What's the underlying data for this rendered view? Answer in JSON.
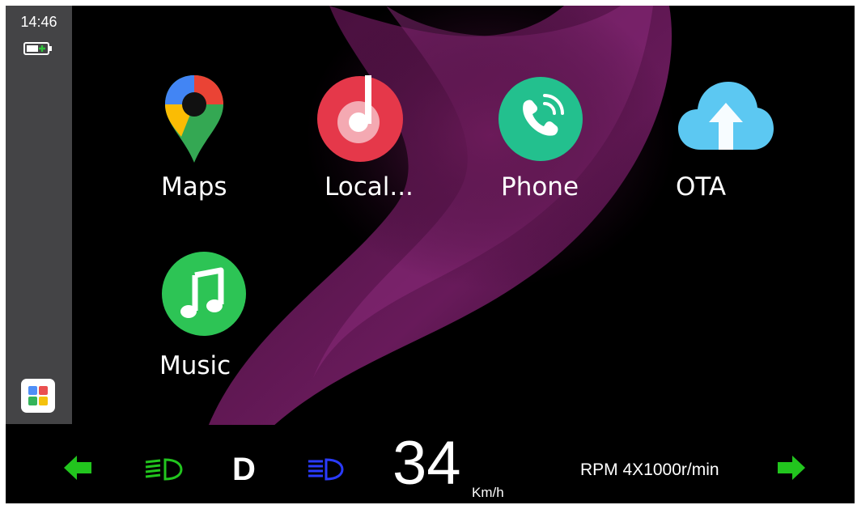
{
  "status_bar": {
    "time": "14:46",
    "battery_icon": "battery-charging-icon"
  },
  "apps": [
    {
      "label": "Maps",
      "icon": "maps-pin-icon"
    },
    {
      "label": "Local...",
      "icon": "local-music-icon"
    },
    {
      "label": "Phone",
      "icon": "phone-icon"
    },
    {
      "label": "OTA",
      "icon": "cloud-upload-icon"
    },
    {
      "label": "Music",
      "icon": "music-note-icon"
    }
  ],
  "dashboard": {
    "gear": "D",
    "speed": "34",
    "speed_unit": "Km/h",
    "rpm_text": "RPM 4X1000r/min",
    "left_turn_icon": "left-turn-signal-icon",
    "right_turn_icon": "right-turn-signal-icon",
    "low_beam_icon": "low-beam-icon",
    "high_beam_icon": "high-beam-icon",
    "colors": {
      "indicator_green": "#22c51e",
      "high_beam_blue": "#2a3bff"
    }
  },
  "launcher_icon": "app-grid-icon"
}
